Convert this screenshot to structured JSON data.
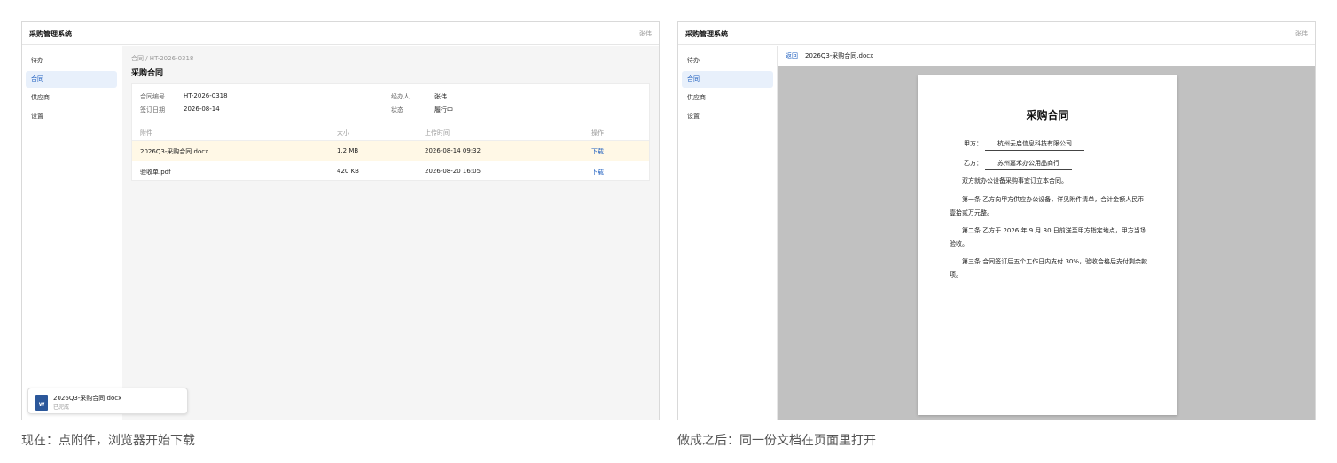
{
  "app": {
    "title": "采购管理系统",
    "user": "张伟"
  },
  "sidebar": {
    "items": [
      "待办",
      "合同",
      "供应商",
      "设置"
    ],
    "active": "合同"
  },
  "before": {
    "breadcrumb": "合同 / HT-2026-0318",
    "page_title": "采购合同",
    "meta": {
      "contract_no_label": "合同编号",
      "contract_no": "HT-2026-0318",
      "sign_date_label": "签订日期",
      "sign_date": "2026-08-14",
      "handler_label": "经办人",
      "handler": "张伟",
      "status_label": "状态",
      "status": "履行中"
    },
    "table": {
      "headers": [
        "附件",
        "大小",
        "上传时间",
        "操作"
      ],
      "rows": [
        {
          "name": "2026Q3-采购合同.docx",
          "size": "1.2 MB",
          "uploaded": "2026-08-14 09:32",
          "action": "下载"
        },
        {
          "name": "验收单.pdf",
          "size": "420 KB",
          "uploaded": "2026-08-20 16:05",
          "action": "下载"
        }
      ]
    },
    "download_toast": {
      "file_icon_letter": "W",
      "file_name": "2026Q3-采购合同.docx",
      "status": "已完成"
    }
  },
  "after": {
    "back_label": "返回",
    "document_name": "2026Q3-采购合同.docx",
    "document": {
      "title": "采购合同",
      "party_a_label": "甲方：",
      "party_a": "杭州云启信息科技有限公司",
      "party_b_label": "乙方：",
      "party_b": "苏州嘉禾办公用品商行",
      "paragraphs": [
        "双方就办公设备采购事宜订立本合同。",
        "第一条 乙方向甲方供应办公设备，详见附件清单，合计金额人民币壹拾贰万元整。",
        "第二条 乙方于 2026 年 9 月 30 日前送至甲方指定地点，甲方当场验收。",
        "第三条 合同签订后五个工作日内支付 30%，验收合格后支付剩余款项。"
      ]
    }
  },
  "captions": {
    "before": "现在：点附件，浏览器开始下载",
    "after": "做成之后：同一份文档在页面里打开"
  },
  "colors": {
    "accent": "#1f5fbf",
    "active_nav_bg": "#e8f0fb",
    "highlight_row": "#fff8e6",
    "viewer_bg": "#c1c1c1",
    "word_icon": "#2b579a"
  }
}
